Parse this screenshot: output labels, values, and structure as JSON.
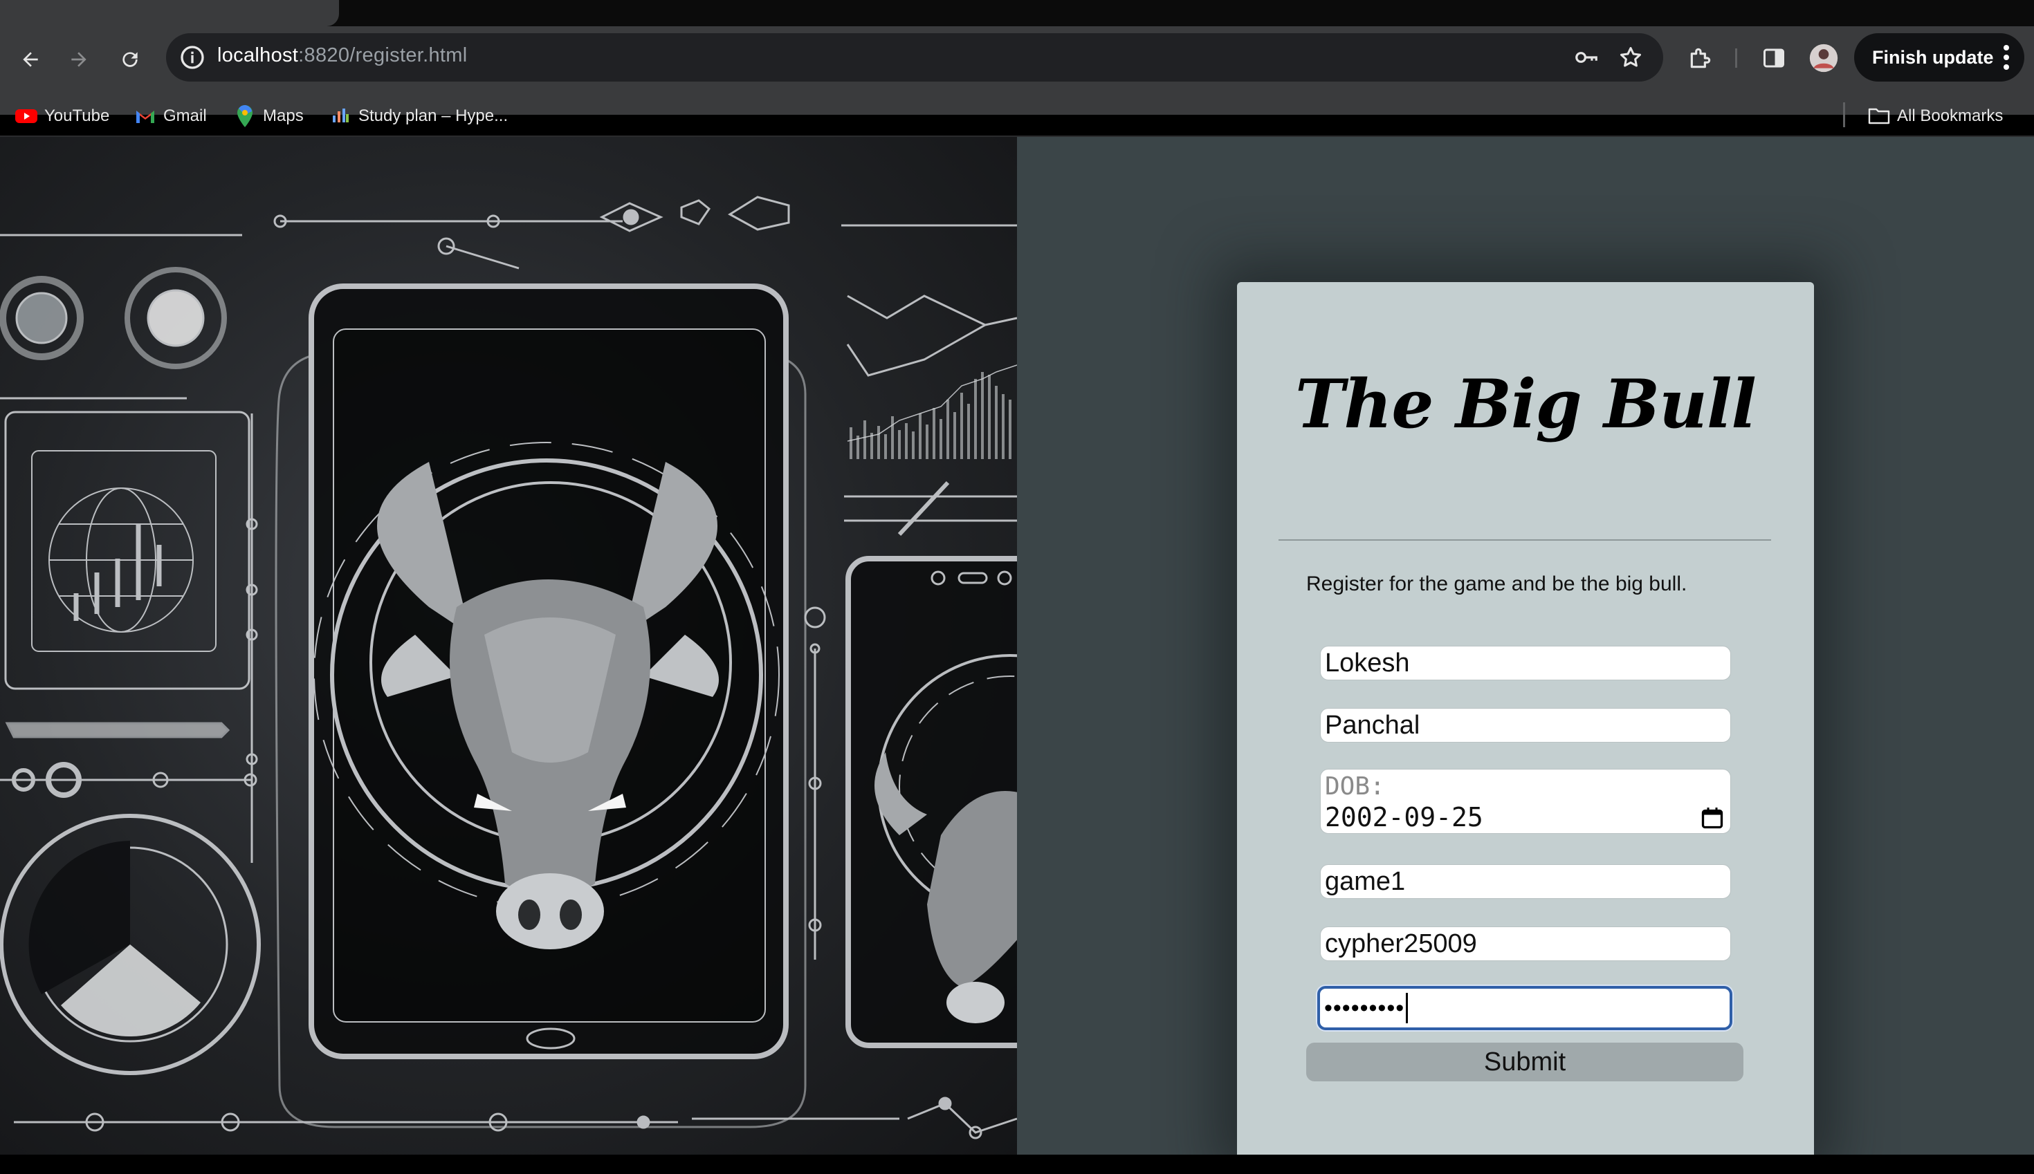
{
  "browser": {
    "url_host": "localhost",
    "url_rest": ":8820/register.html",
    "finish_update_label": "Finish update",
    "bookmarks": [
      {
        "label": "YouTube",
        "icon": "youtube-icon"
      },
      {
        "label": "Gmail",
        "icon": "gmail-icon"
      },
      {
        "label": "Maps",
        "icon": "maps-icon"
      },
      {
        "label": "Study plan – Hype...",
        "icon": "hype-icon"
      }
    ],
    "all_bookmarks_label": "All Bookmarks"
  },
  "form": {
    "title": "The Big Bull",
    "tagline": "Register for the game and be the big bull.",
    "first_name": "Lokesh",
    "last_name": "Panchal",
    "dob_label": "DOB:",
    "dob_value": "2002-09-25",
    "username": "game1",
    "email": "cypher25009",
    "password_masked": "•••••••••",
    "submit_label": "Submit"
  },
  "colors": {
    "page_bg": "#3b4548",
    "card_bg": "#c4cfd0",
    "focus_ring": "#2f5fa8"
  }
}
